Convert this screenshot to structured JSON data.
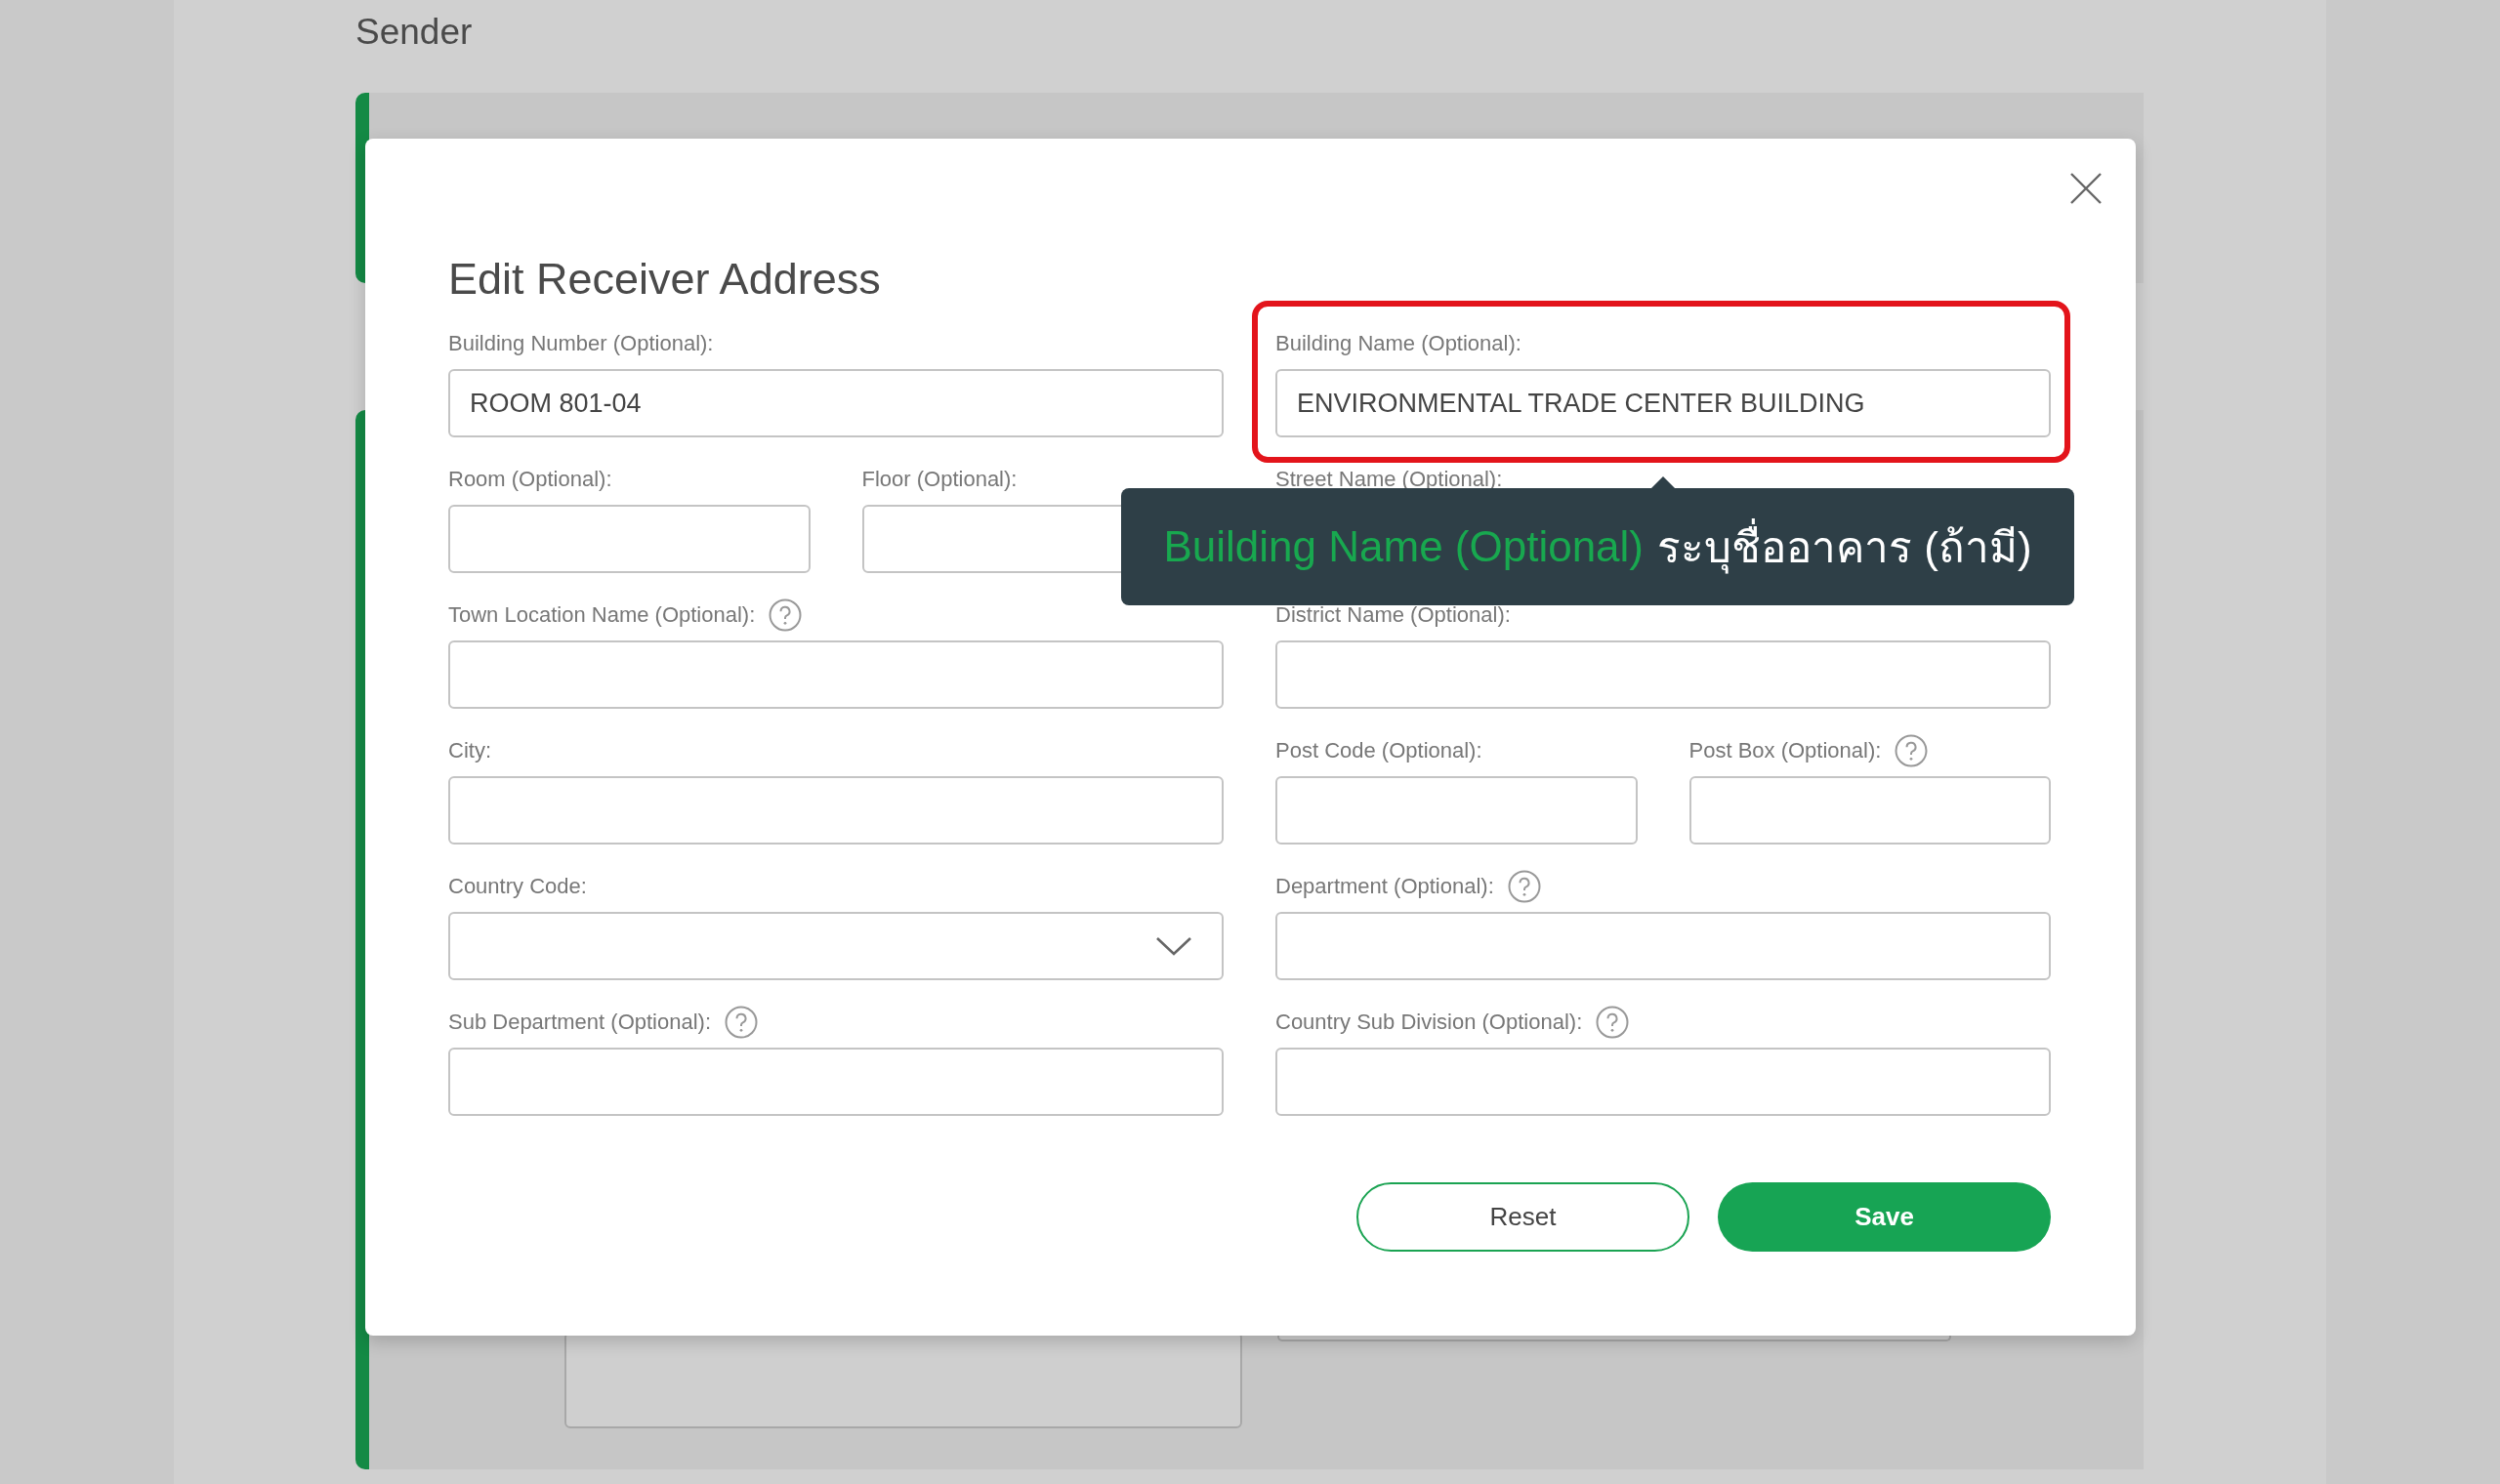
{
  "background": {
    "section_title": "Sender"
  },
  "modal": {
    "title": "Edit Receiver Address",
    "rows": [
      [
        [
          {
            "kind": "text",
            "label": "Building Number (Optional):",
            "value": "ROOM 801-04"
          }
        ],
        [
          {
            "kind": "text",
            "label": "Building Name (Optional):",
            "value": "ENVIRONMENTAL TRADE CENTER BUILDING",
            "highlighted": true
          }
        ]
      ],
      [
        [
          {
            "kind": "text",
            "label": "Room (Optional):"
          },
          {
            "kind": "text",
            "label": "Floor (Optional):"
          }
        ],
        [
          {
            "kind": "text",
            "label": "Street Name (Optional):"
          }
        ]
      ],
      [
        [
          {
            "kind": "text",
            "label": "Town Location Name (Optional):",
            "help": true
          }
        ],
        [
          {
            "kind": "text",
            "label": "District Name (Optional):"
          }
        ]
      ],
      [
        [
          {
            "kind": "text",
            "label": "City:"
          }
        ],
        [
          {
            "kind": "text",
            "label": "Post Code (Optional):"
          },
          {
            "kind": "text",
            "label": "Post Box (Optional):",
            "help": true
          }
        ]
      ],
      [
        [
          {
            "kind": "select",
            "label": "Country Code:"
          }
        ],
        [
          {
            "kind": "text",
            "label": "Department (Optional):",
            "help": true
          }
        ]
      ],
      [
        [
          {
            "kind": "text",
            "label": "Sub Department (Optional):",
            "help": true
          }
        ],
        [
          {
            "kind": "text",
            "label": "Country Sub Division (Optional):",
            "help": true
          }
        ]
      ]
    ],
    "buttons": [
      {
        "kind": "outline",
        "label": "Reset"
      },
      {
        "kind": "primary",
        "label": "Save"
      }
    ]
  },
  "tooltip": {
    "term": "Building Name (Optional)",
    "text": "ระบุชื่ออาคาร (ถ้ามี)"
  }
}
